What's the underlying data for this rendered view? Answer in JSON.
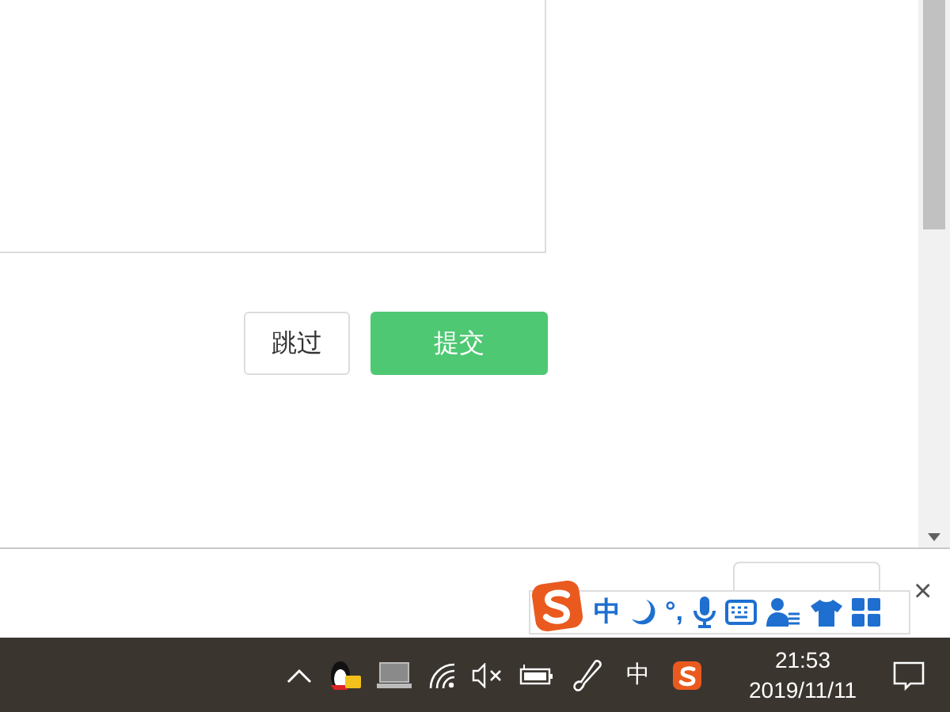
{
  "content_buttons": [
    {
      "label": "跳过",
      "kind": "secondary"
    },
    {
      "label": "提交",
      "kind": "primary"
    }
  ],
  "bottom_bar": {
    "close": "×"
  },
  "ime_toolbar": {
    "mode": "中",
    "punctuation": "°,"
  },
  "taskbar": {
    "input_indicator": "中",
    "time": "21:53",
    "date": "2019/11/11"
  }
}
